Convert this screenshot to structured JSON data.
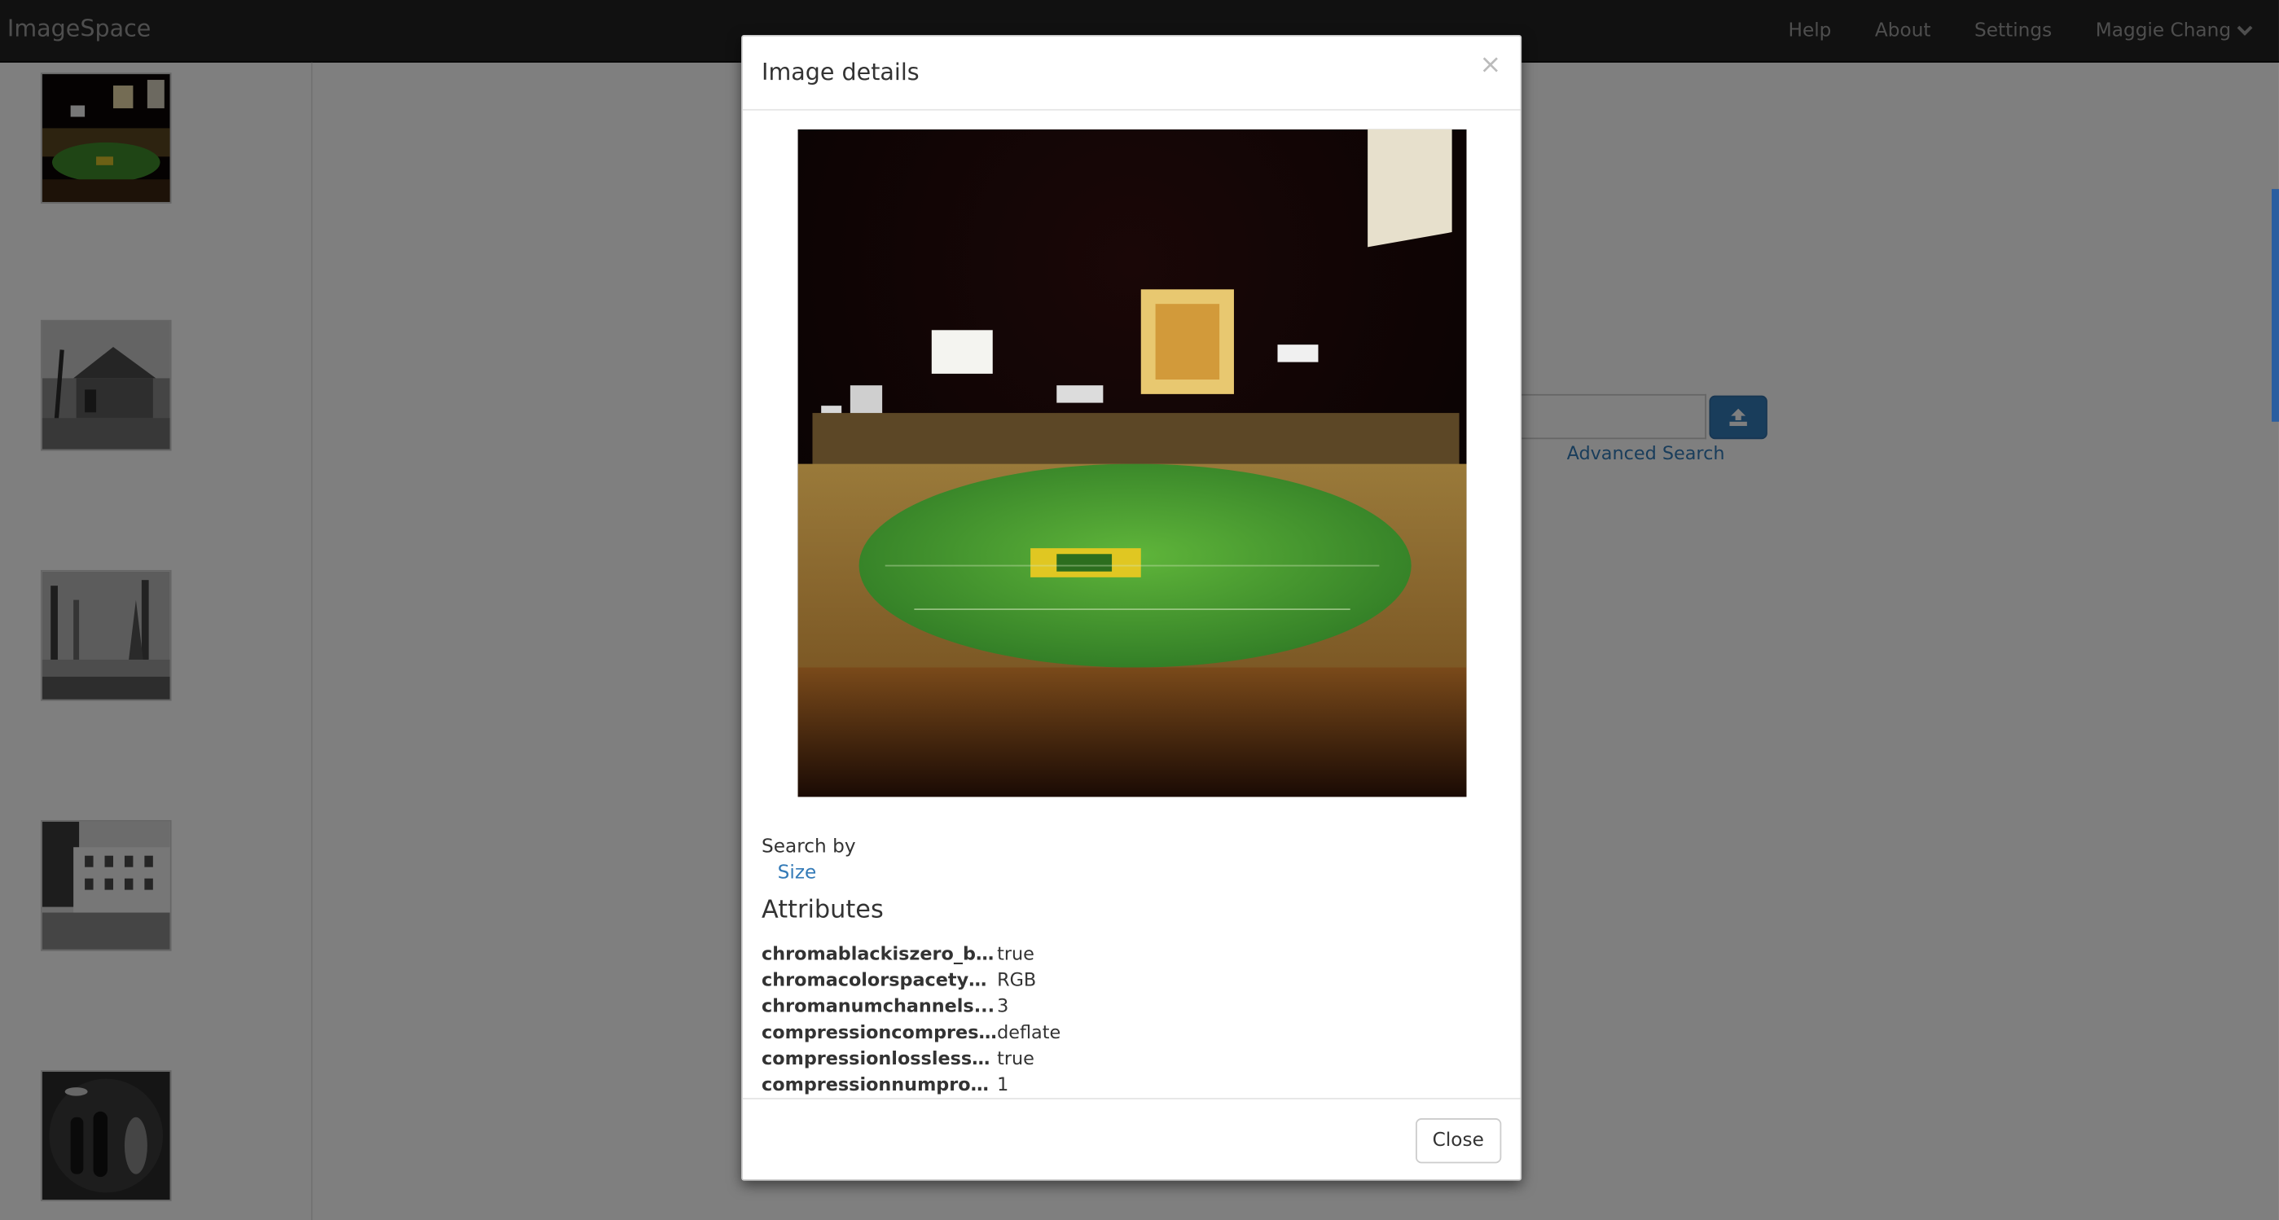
{
  "app": {
    "brand": "ImageSpace"
  },
  "navbar": {
    "links": [
      "Help",
      "About",
      "Settings"
    ],
    "user": "Maggie Chang",
    "user_icon": "chevron-down-icon"
  },
  "main": {
    "advanced_search": "Advanced Search",
    "upload_icon": "upload-icon"
  },
  "sidebar": {
    "thumbnails": [
      {
        "subject": "stadium at night"
      },
      {
        "subject": "old house with tree"
      },
      {
        "subject": "foggy forest"
      },
      {
        "subject": "white colonial house"
      },
      {
        "subject": "ghostly figures"
      }
    ]
  },
  "modal": {
    "title": "Image details",
    "close_icon": "×",
    "search_by_label": "Search by",
    "search_by_link": "Size",
    "attributes_heading": "Attributes",
    "attributes": [
      {
        "key": "chromablackiszero_b_...",
        "value": "true"
      },
      {
        "key": "chromacolorspacetyp...",
        "value": "RGB"
      },
      {
        "key": "chromanumchannels...",
        "value": "3"
      },
      {
        "key": "compressioncompres...",
        "value": "deflate"
      },
      {
        "key": "compressionlossless_...",
        "value": "true"
      },
      {
        "key": "compressionnumprog...",
        "value": "1"
      }
    ],
    "close_button": "Close"
  },
  "colors": {
    "navbar_bg": "#222222",
    "link": "#337ab7",
    "primary_button": "#337ab7"
  }
}
